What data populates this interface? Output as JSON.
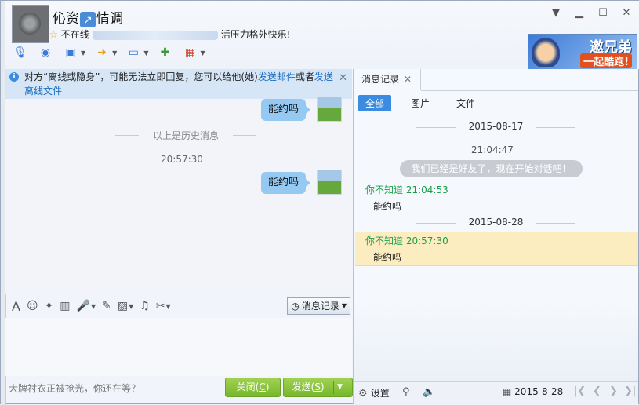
{
  "header": {
    "nickname_prefix": "伈资",
    "nickname_suffix": "情调",
    "status_prefix": "不在线",
    "status_suffix": "活压力格外快乐!",
    "banner_line1": "邀兄弟",
    "banner_line2": "一起酷跑!"
  },
  "notice": {
    "text_a": "对方“离线或隐身”，可能无法立即回复，您可以给他(她)",
    "link_email": "发送邮件",
    "text_or": "或者",
    "link_file": "发送离线文件"
  },
  "chat": {
    "messages": [
      {
        "text": "能约吗"
      },
      {
        "text": "能约吗"
      }
    ],
    "history_divider": "以上是历史消息",
    "time": "20:57:30"
  },
  "input": {
    "history_button": "消息记录",
    "ad_text": "大牌衬衣正被抢光，你还在等？",
    "close_label": "关闭",
    "close_key": "C",
    "send_label": "发送",
    "send_key": "S"
  },
  "record": {
    "tab_title": "消息记录",
    "filters": [
      "全部",
      "图片",
      "文件"
    ],
    "date1": "2015-08-17",
    "time1": "21:04:47",
    "system_msg": "我们已经是好友了，现在开始对话吧！",
    "sender1": "你不知道",
    "sender1_time": "21:04:53",
    "msg1": "能约吗",
    "date2": "2015-08-28",
    "sender2": "你不知道",
    "sender2_time": "20:57:30",
    "msg2": "能约吗",
    "settings_label": "设置",
    "current_date": "2015-8-28"
  },
  "colors": {
    "accent": "#3b8ce1",
    "bubble": "#96c9f2",
    "sender_green": "#1c9d4a",
    "highlight": "#fbedbf",
    "button_green": "#76b72b"
  }
}
